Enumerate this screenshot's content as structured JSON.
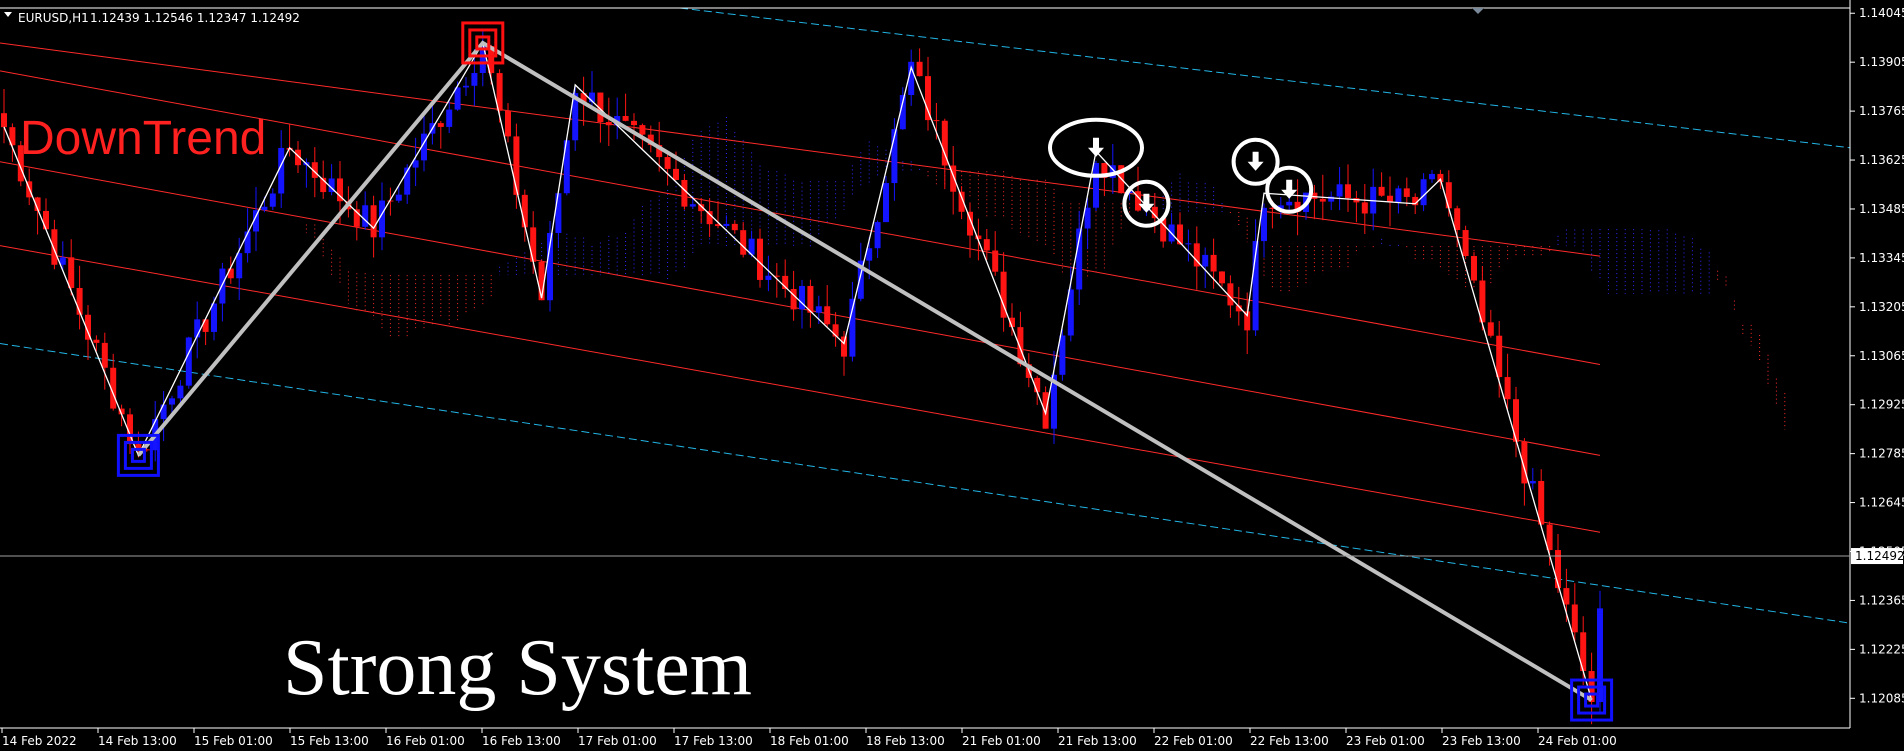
{
  "header": {
    "symbol": "EURUSD,H1",
    "ohlc": "1.12439 1.12546 1.12347 1.12492"
  },
  "overlay": {
    "trend_label": "DownTrend",
    "brand_label": "Strong System"
  },
  "colors": {
    "background": "#000000",
    "bull": "#1414ff",
    "bear": "#ff1414",
    "zigzag_thin": "#ffffff",
    "zigzag_thick": "#c0c0c0",
    "channel_red": "#ff2a2a",
    "channel_cyan": "#22b5e6",
    "kumo_bear": "#ff2a2a",
    "kumo_bull": "#2a2aff",
    "grid_text": "#ffffff"
  },
  "icons": [
    "collapse-triangle-icon",
    "down-arrow-icon",
    "highlight-circle-icon",
    "square-target-icon"
  ],
  "chart_data": {
    "type": "candlestick",
    "symbol": "EURUSD",
    "timeframe": "H1",
    "ylim": [
      1.12,
      1.1406
    ],
    "y_ticks": [
      "1.14045",
      "1.13905",
      "1.13765",
      "1.13625",
      "1.13485",
      "1.13345",
      "1.13205",
      "1.13065",
      "1.12925",
      "1.12785",
      "1.12645",
      "1.12505",
      "1.12365",
      "1.12225",
      "1.12085"
    ],
    "current_price": "1.12492",
    "x_labels": [
      "14 Feb 2022",
      "14 Feb 13:00",
      "15 Feb 01:00",
      "15 Feb 13:00",
      "16 Feb 01:00",
      "16 Feb 13:00",
      "17 Feb 01:00",
      "17 Feb 13:00",
      "18 Feb 01:00",
      "18 Feb 13:00",
      "21 Feb 01:00",
      "21 Feb 13:00",
      "22 Feb 01:00",
      "22 Feb 13:00",
      "23 Feb 01:00",
      "23 Feb 13:00",
      "24 Feb 01:00"
    ],
    "bars_total": 200,
    "zigzag_points": [
      {
        "bar": 0,
        "price": 1.1372
      },
      {
        "bar": 16,
        "price": 1.1278
      },
      {
        "bar": 34,
        "price": 1.1366
      },
      {
        "bar": 44,
        "price": 1.1343
      },
      {
        "bar": 57,
        "price": 1.1396
      },
      {
        "bar": 64,
        "price": 1.1323
      },
      {
        "bar": 68,
        "price": 1.1384
      },
      {
        "bar": 100,
        "price": 1.131
      },
      {
        "bar": 108,
        "price": 1.1389
      },
      {
        "bar": 124,
        "price": 1.129
      },
      {
        "bar": 130,
        "price": 1.1365
      },
      {
        "bar": 148,
        "price": 1.1318
      },
      {
        "bar": 150,
        "price": 1.1353
      },
      {
        "bar": 168,
        "price": 1.135
      },
      {
        "bar": 171,
        "price": 1.1357
      },
      {
        "bar": 189,
        "price": 1.1208
      }
    ],
    "major_swings": [
      {
        "bar": 16,
        "price": 1.1278,
        "type": "low"
      },
      {
        "bar": 57,
        "price": 1.1396,
        "type": "high"
      },
      {
        "bar": 189,
        "price": 1.1208,
        "type": "low"
      }
    ],
    "sell_signals": [
      {
        "bar": 130,
        "price": 1.1366
      },
      {
        "bar": 136,
        "price": 1.135
      },
      {
        "bar": 149,
        "price": 1.1362
      },
      {
        "bar": 153,
        "price": 1.1354
      }
    ],
    "legend": "none",
    "grid": false
  }
}
